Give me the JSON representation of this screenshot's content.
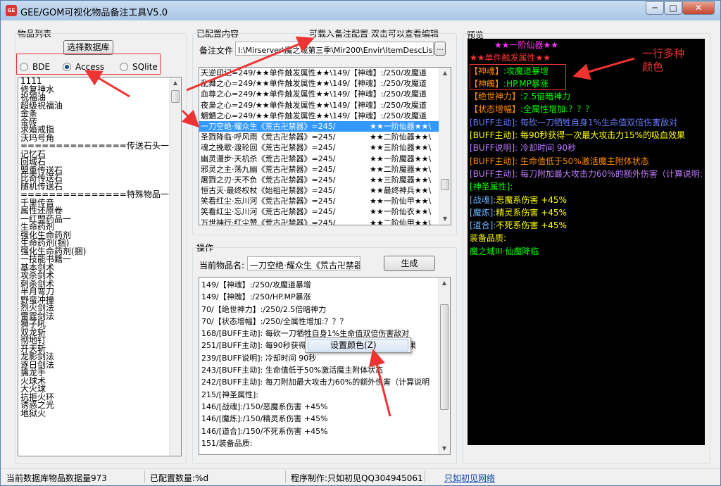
{
  "window": {
    "title": "GEE/GOM可视化物品备注工具V5.0",
    "app_icon_text": "GE"
  },
  "left_panel": {
    "label": "物品列表",
    "select_db_button": "选择数据库",
    "db_options": [
      {
        "label": "BDE",
        "selected": false
      },
      {
        "label": "Access",
        "selected": true
      },
      {
        "label": "SQlite",
        "selected": false
      }
    ],
    "items": [
      "1111",
      "修复神水",
      "祝福油",
      "超级祝福油",
      "金条",
      "金砖",
      "求婚戒指",
      "沃玛号角",
      "===============传送石头一",
      "记忆石",
      "回城石",
      "盟重传送石",
      "比奇传送石",
      "随机传送石",
      "===============特殊物品一",
      "千里传音",
      "属性还原卷",
      "一红盟药品一",
      "生命药剂",
      "强化生命药剂",
      "生命药剂(捆)",
      "强化生命药剂(捆)",
      "一技能书籍一",
      "基本剑术",
      "攻杀剑术",
      "刺杀剑术",
      "半月弯刀",
      "野蛮冲撞",
      "烈火剑法",
      "雷霆剑法",
      "狮子吼",
      "双龙斩",
      "彻地钉",
      "开天斩",
      "龙影剑法",
      "逐日剑法",
      "擒龙手",
      "火球术",
      "大火球",
      "抗拒火环",
      "诱惑之光",
      "地狱火"
    ]
  },
  "config_panel": {
    "label": "已配置内容",
    "hint": "可载入备注配置 双击可以查看编辑",
    "file_label": "备注文件",
    "file_path": "I:\\Mirserver\\魔之域第三季\\Mir200\\Envir\\ItemDescList.txt",
    "browse_label": "...",
    "rows": [
      {
        "left": "天逆印记=249/★★单件触发属性★★\\149/【神魂】:/250/攻魔道",
        "right": "",
        "selected": false
      },
      {
        "left": "乱舞之心=249/★★单件触发属性★★\\149/【神魂】:/250/攻魔道",
        "right": "",
        "selected": false
      },
      {
        "left": "血尊之心=249/★★单件触发属性★★\\149/【神魂】:/250/攻魔道",
        "right": "",
        "selected": false
      },
      {
        "left": "夜枭之心=249/★★单件触发属性★★\\149/【神魂】:/250/攻魔道",
        "right": "",
        "selected": false
      },
      {
        "left": "魍魉之心=249/★★单件触发属性★★\\149/【神魂】:/250/攻魔道",
        "right": "",
        "selected": false
      },
      {
        "left": "一刀空绝·耀众生《荒古卍禁器》=245/",
        "right": "★★一阶仙器★★\\",
        "selected": true
      },
      {
        "left": "圣戮降临·呼风雨《荒古卍禁器》=245/",
        "right": "★★二阶仙器★★\\",
        "selected": false
      },
      {
        "left": "魂之挽歌·渡轮回《荒古卍禁器》=245/",
        "right": "★★三阶仙器★★\\",
        "selected": false
      },
      {
        "left": "幽灵漫步·天机杀《荒古卍禁器》=245/",
        "right": "★★一阶魔器★★\\",
        "selected": false
      },
      {
        "left": "邪灵之主·荡九幽《荒古卍禁器》=245/",
        "right": "★★二阶魔器★★\\",
        "selected": false
      },
      {
        "left": "屠戮之刃·天不负《荒古卍禁器》=245/",
        "right": "★★三阶魔器★★\\",
        "selected": false
      },
      {
        "left": "恒古灭·最终权杖《始祖卍禁器》=245/",
        "right": "★★最终神兵★★\\",
        "selected": false
      },
      {
        "left": "笑看红尘·忘川河《荒古卍禁器》=245/",
        "right": "★★一阶仙甲★★\\",
        "selected": false
      },
      {
        "left": "笑看红尘·忘川河《荒古卍禁器》=245/",
        "right": "★★一阶仙衣★★\\",
        "selected": false
      },
      {
        "left": "万世神行·红尘赞《荒古卍禁器》=245/",
        "right": "★★二阶仙甲★★\\",
        "selected": false
      }
    ]
  },
  "operation_panel": {
    "label": "操作",
    "current_item_label": "当前物品名:",
    "current_item_value": "一刀空绝·耀众生《荒古卍禁器",
    "generate_button": "生成",
    "lines": [
      "149/【神魂】:/250/攻魔道暴增",
      "149/【神魄】:/250/HP.MP暴涨",
      "70/【绝世神力】:/250/2.5倍暗神力",
      "70/【状态增幅】:/250/全属性增加:？？？",
      "168/[BUFF主动]: 每砍一刀牺牲自身1%生命值双倍伤害敌对",
      "251/[BUFF主动]: 每90秒获得一次最大攻击力15%的吸血效果",
      "239/[BUFF说明]: 冷却时间 90秒",
      "243/[BUFF主动]: 生命值低于50%激活魔主附体状态",
      "242/[BUFF主动]: 每刀附加最大攻击力60%的额外伤害（计算说明",
      "215/[神圣属性]:",
      "146/[战魂]:/150/恶魔系伤害 +45%",
      "146/[魔炼]:/150/精灵系伤害 +45%",
      "146/[道合]:/150/不死系伤害 +45%",
      "151/装备品质:"
    ]
  },
  "context_menu": {
    "item": "设置颜色(Z)"
  },
  "preview_panel": {
    "label": "预览",
    "lines": [
      {
        "text": "★★一阶仙器★★",
        "color": "#ff33ff",
        "indent": true
      },
      {
        "text": "★★单件触发属性★★",
        "color": "#ff3333",
        "indent": false
      },
      {
        "text": "【神魂】:攻魔道暴增",
        "color": "#00ff00",
        "parts": [
          {
            "text": "【神魂】",
            "color": "#ff8c00"
          },
          {
            "text": ":攻魔道暴增",
            "color": "#00ff00"
          }
        ]
      },
      {
        "text": "【神魄】:HP.MP暴涨",
        "color": "#00ff00",
        "parts": [
          {
            "text": "【神魄】",
            "color": "#ff8c00"
          },
          {
            "text": ":HP.MP暴涨",
            "color": "#00ff00"
          }
        ]
      },
      {
        "text": "【绝世神力】:2.5倍暗神力",
        "color": "#00ff00",
        "parts": [
          {
            "text": "【绝世神力】",
            "color": "#ff8c00"
          },
          {
            "text": ":2.5倍暗神力",
            "color": "#00ff00"
          }
        ]
      },
      {
        "text": "【状态增幅】:全属性增加:？？？",
        "color": "#00ff00",
        "parts": [
          {
            "text": "【状态增幅】",
            "color": "#ff8c00"
          },
          {
            "text": ":全属性增加:？？？",
            "color": "#00ff00"
          }
        ]
      },
      {
        "text": "[BUFF主动]: 每砍一刀牺牲自身1%生命值双倍伤害敌对",
        "color": "#6a7cff"
      },
      {
        "text": "[BUFF主动]: 每90秒获得一次最大攻击力15%的吸血效果",
        "color": "#ffff00"
      },
      {
        "text": "[BUFF说明]: 冷却时间 90秒",
        "color": "#c07cff"
      },
      {
        "text": "[BUFF主动]: 生命值低于50%激活魔主附体状态",
        "color": "#ff8c00"
      },
      {
        "text": "[BUFF主动]: 每刀附加最大攻击力60%的额外伤害（计算说明:",
        "color": "#c07cff"
      },
      {
        "text": "[神圣属性]:",
        "color": "#00ff00"
      },
      {
        "text": "[战魂]:恶魔系伤害 +45%",
        "color": "#ffff00",
        "parts": [
          {
            "text": "[战魂]:",
            "color": "#6ab4ff"
          },
          {
            "text": "恶魔系伤害 +45%",
            "color": "#ffff00"
          }
        ]
      },
      {
        "text": "[魔炼]:精灵系伤害 +45%",
        "color": "#ffff00",
        "parts": [
          {
            "text": "[魔炼]:",
            "color": "#6ab4ff"
          },
          {
            "text": "精灵系伤害 +45%",
            "color": "#ffff00"
          }
        ]
      },
      {
        "text": "[道合]:不死系伤害 +45%",
        "color": "#ffff00",
        "parts": [
          {
            "text": "[道合]:",
            "color": "#6ab4ff"
          },
          {
            "text": "不死系伤害 +45%",
            "color": "#ffff00"
          }
        ]
      },
      {
        "text": "装备品质:",
        "color": "#ffff00"
      },
      {
        "text": "魔之域III·仙魔降临",
        "color": "#00ff00"
      }
    ]
  },
  "annotation": {
    "text_line1": "一行多种",
    "text_line2": "颜色",
    "color": "#ee3333"
  },
  "statusbar": {
    "db_count": "当前数据库物品数据量973",
    "configured_count": "已配置数量:%d",
    "author": "程序制作:只如初见QQ304945061",
    "link": "只如初见网络"
  }
}
